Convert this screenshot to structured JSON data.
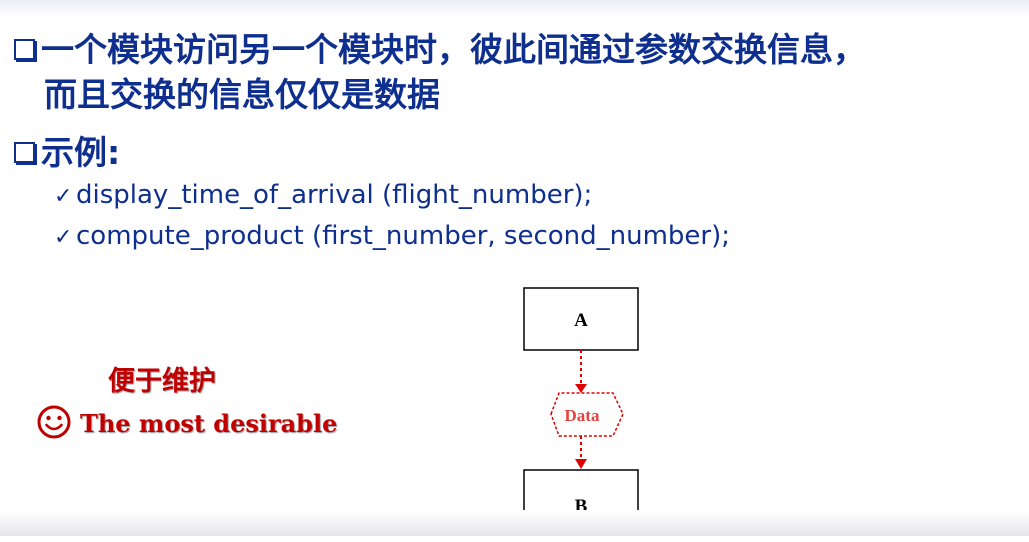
{
  "bullets": {
    "line1": "一个模块访问另一个模块时，彼此间通过参数交换信息，",
    "line1_cont": "而且交换的信息仅仅是数据",
    "line2": "示例:"
  },
  "examples": [
    {
      "check": "✓",
      "text": "display_time_of_arrival (flight_number);"
    },
    {
      "check": "✓",
      "text": "compute_product (first_number, second_number);"
    }
  ],
  "callout": {
    "heading": "便于维护",
    "desirable": "The most desirable"
  },
  "diagram": {
    "box_a": "A",
    "data": "Data",
    "box_b": "B"
  },
  "colors": {
    "title_blue": "#0f2f8f",
    "accent_red": "#c00000",
    "arrow_red": "#e00000"
  },
  "icons": {
    "bullet": "hollow-square-bullet-icon",
    "check": "check-mark-icon",
    "smile": "smiley-face-icon"
  }
}
